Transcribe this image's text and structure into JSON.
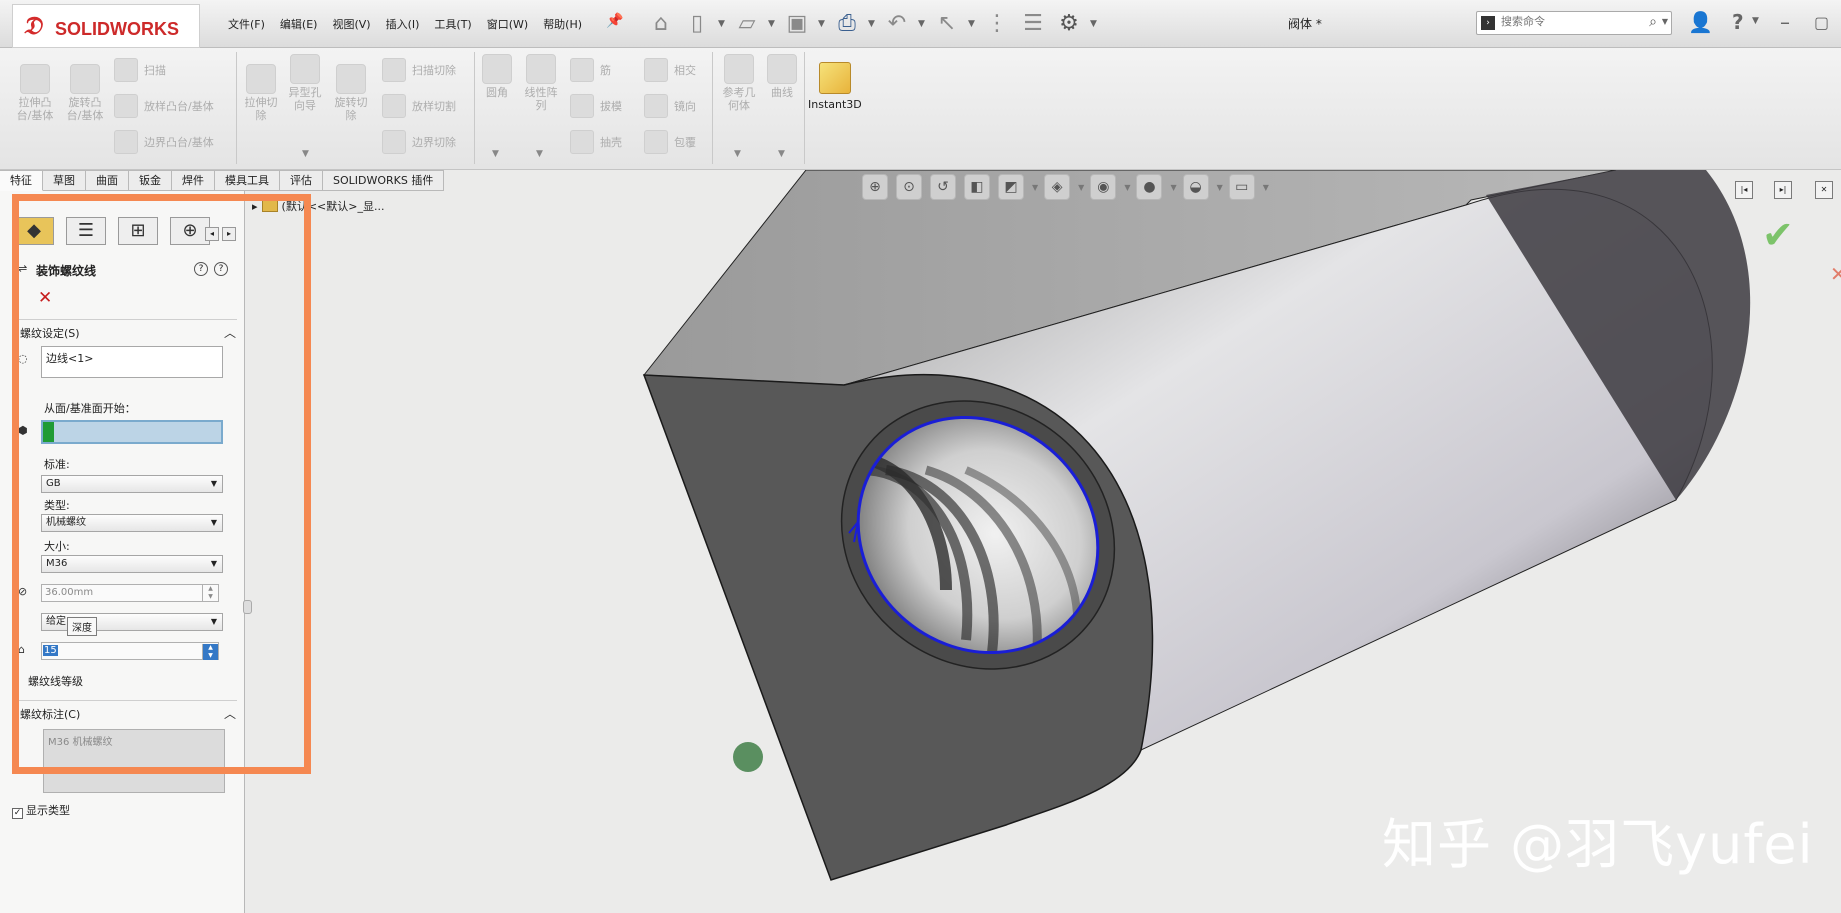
{
  "app": {
    "name": "SOLIDWORKS",
    "doc_title": "阀体 *"
  },
  "menu": [
    "文件(F)",
    "编辑(E)",
    "视图(V)",
    "插入(I)",
    "工具(T)",
    "窗口(W)",
    "帮助(H)"
  ],
  "search": {
    "placeholder": "搜索命令"
  },
  "toolbar": {
    "extrude_boss": "拉伸凸\n台/基体",
    "revolve_boss": "旋转凸\n台/基体",
    "sweep": "扫描",
    "loft": "放样凸台/基体",
    "boundary_boss": "边界凸台/基体",
    "extrude_cut": "拉伸切\n除",
    "hole_wizard": "异型孔\n向导",
    "revolve_cut": "旋转切\n除",
    "swept_cut": "扫描切除",
    "lofted_cut": "放样切割",
    "boundary_cut": "边界切除",
    "fillet": "圆角",
    "linear_pattern": "线性阵\n列",
    "rib": "筋",
    "draft": "拔模",
    "shell": "抽壳",
    "intersect": "相交",
    "mirror": "镜向",
    "wrap": "包覆",
    "ref_geometry": "参考几\n何体",
    "curves": "曲线",
    "instant3d": "Instant3D"
  },
  "tabs": [
    "特征",
    "草图",
    "曲面",
    "钣金",
    "焊件",
    "模具工具",
    "评估",
    "SOLIDWORKS 插件"
  ],
  "tree": {
    "path": "(默认<<默认>_显..."
  },
  "property_manager": {
    "title": "装饰螺纹线",
    "section_thread": "螺纹设定(S)",
    "edge_value": "边线<1>",
    "from_face_label": "从面/基准面开始：",
    "standard_label": "标准:",
    "standard_value": "GB",
    "type_label": "类型:",
    "type_value": "机械螺纹",
    "size_label": "大小:",
    "size_value": "M36",
    "diameter_value": "36.00mm",
    "end_condition_value": "给定",
    "tooltip": "深度",
    "depth_value": "15",
    "thread_class": "螺纹线等级",
    "section_callout": "螺纹标注(C)",
    "callout_value": "M36 机械螺纹",
    "show_type": "显示类型"
  },
  "watermark": "知乎 @羽飞yufei",
  "colors": {
    "highlight": "#f58851",
    "thread_edge": "#1a1ed6",
    "face_select": "#1f9b35",
    "ok": "#7cc36a"
  }
}
